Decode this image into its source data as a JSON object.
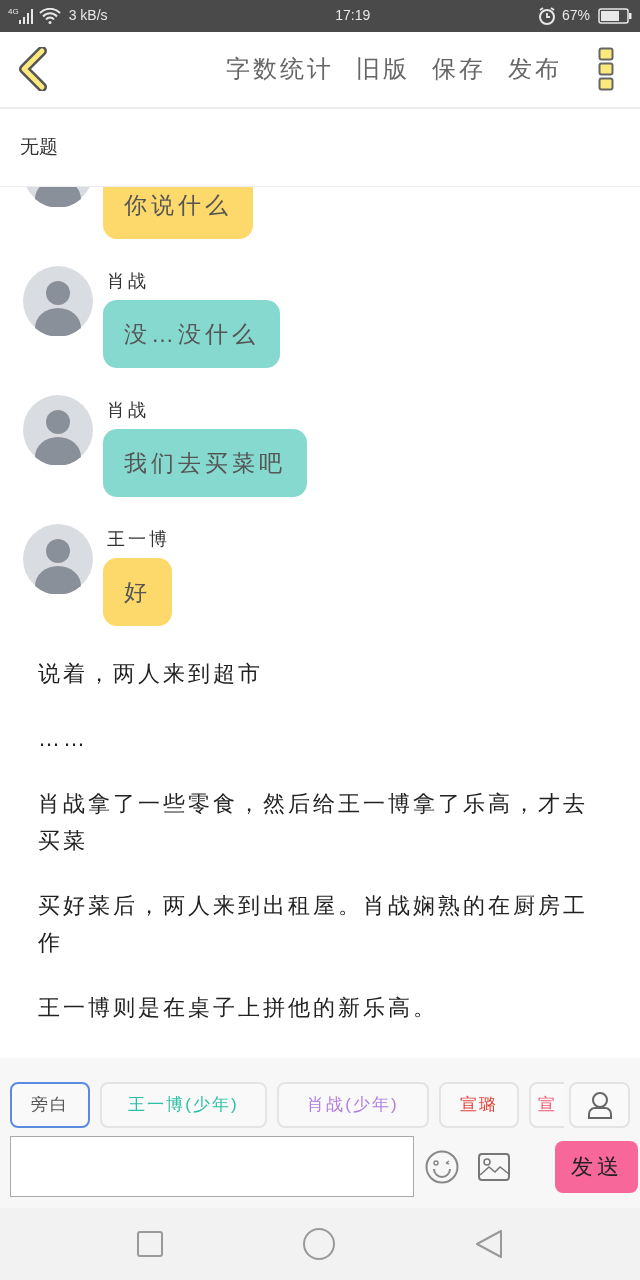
{
  "status_bar": {
    "network": "4G",
    "speed": "3 kB/s",
    "time": "17:19",
    "battery": "67%"
  },
  "toolbar": {
    "actions": [
      "字数统计",
      "旧版",
      "保存",
      "发布"
    ]
  },
  "document": {
    "title": "无题"
  },
  "messages": [
    {
      "text": "你说什么",
      "color": "#fdd96b"
    },
    {
      "name": "肖战",
      "text": "没…没什么",
      "color": "#86d9cf"
    },
    {
      "name": "肖战",
      "text": "我们去买菜吧",
      "color": "#86d9cf"
    },
    {
      "name": "王一博",
      "text": "好",
      "color": "#fdd96b"
    }
  ],
  "narration": [
    "说着，两人来到超市",
    "……",
    "肖战拿了一些零食，然后给王一博拿了乐高，才去买菜",
    "买好菜后，两人来到出租屋。肖战娴熟的在厨房工作",
    "王一博则是在桌子上拼他的新乐高。"
  ],
  "speakers": [
    {
      "label": "旁白",
      "selected": true,
      "color": "#555555"
    },
    {
      "label": "王一博(少年)",
      "selected": false,
      "color": "#2bbfa4"
    },
    {
      "label": "肖战(少年)",
      "selected": false,
      "color": "#b07ee0"
    },
    {
      "label": "宣璐",
      "selected": false,
      "color": "#e0443a"
    },
    {
      "label": "宣",
      "selected": false,
      "color": "#ee5a6f"
    }
  ],
  "composer": {
    "send": "发送"
  }
}
